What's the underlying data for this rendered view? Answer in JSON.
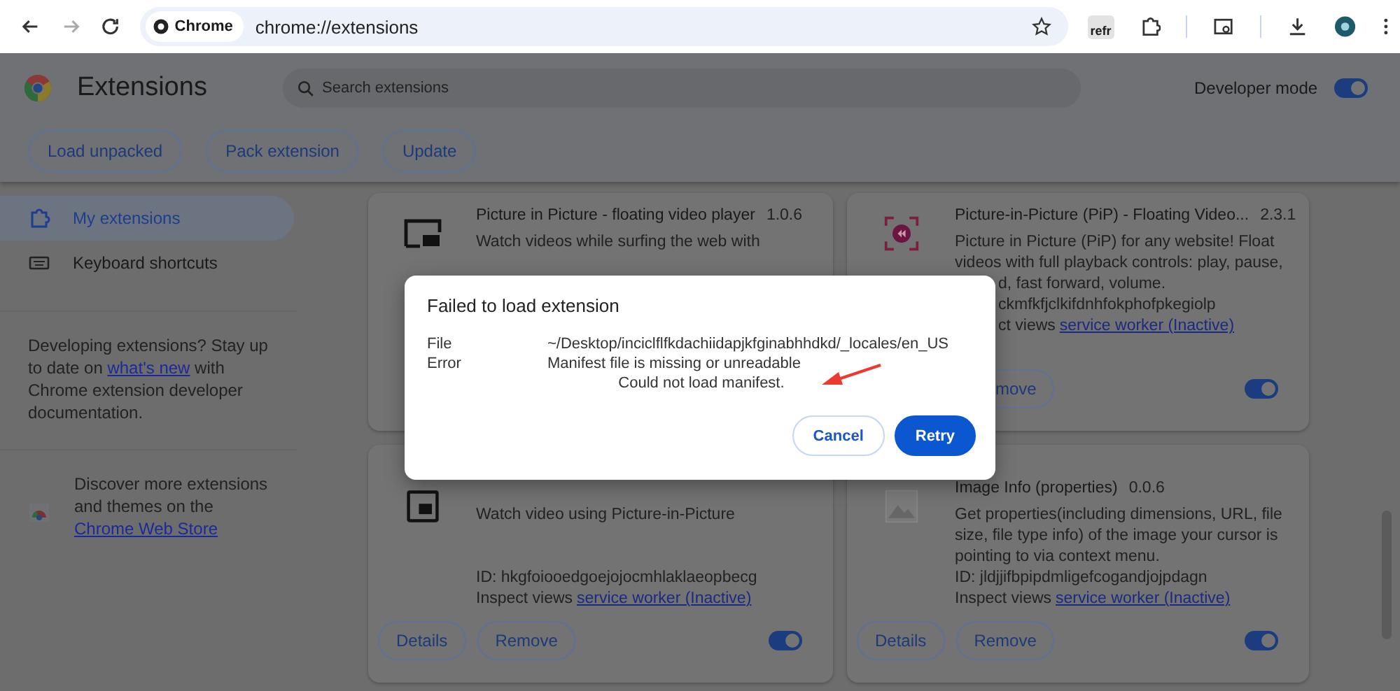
{
  "browser": {
    "site_chip": "Chrome",
    "url": "chrome://extensions",
    "extension_badge": "refr"
  },
  "header": {
    "title": "Extensions",
    "search_placeholder": "Search extensions",
    "developer_mode": {
      "label": "Developer mode",
      "on": true
    }
  },
  "toolbar_buttons": [
    "Load unpacked",
    "Pack extension",
    "Update"
  ],
  "sidebar": {
    "items": [
      {
        "label": "My extensions",
        "selected": true
      },
      {
        "label": "Keyboard shortcuts",
        "selected": false
      }
    ],
    "developer_note": {
      "before": "Developing extensions? Stay up to date on ",
      "link": "what's new",
      "after": " with Chrome extension developer documentation."
    },
    "store_note": {
      "before": "Discover more extensions and themes on the ",
      "link": "Chrome Web Store"
    }
  },
  "cards": [
    {
      "name": "Picture in Picture - floating video player",
      "version": "1.0.6",
      "description_lines": [
        "Watch videos while surfing the web with"
      ]
    },
    {
      "name": "Picture-in-Picture (PiP) - Floating Video...",
      "version": "2.3.1",
      "description_lines": [
        "Picture in Picture (PiP) for any website! Float",
        "videos with full playback controls: play, pause,"
      ],
      "cut_lines": [
        "d, fast forward, volume.",
        "ckmfkfjclkifdnhfokphofpkegiolp"
      ],
      "inspect_label": "ct views",
      "inspect_link": "service worker (Inactive)",
      "cut_buttons": [
        "move"
      ],
      "enabled": true
    },
    {
      "description_lines": [
        "Watch video using Picture-in-Picture"
      ],
      "id": "ID: hkgfoiooedgoejojocmhlaklaeopbecg",
      "inspect_label": "Inspect views",
      "inspect_link": "service worker (Inactive)",
      "buttons": [
        "Details",
        "Remove"
      ],
      "enabled": true
    },
    {
      "name": "Image Info (properties)",
      "version": "0.0.6",
      "description_lines": [
        "Get properties(including dimensions, URL, file",
        "size, file type info) of the image your cursor is",
        "pointing to via context menu."
      ],
      "id": "ID: jldjjifbpipdmligefcogandjojpdagn",
      "inspect_label": "Inspect views",
      "inspect_link": "service worker (Inactive)",
      "buttons": [
        "Details",
        "Remove"
      ],
      "enabled": true
    }
  ],
  "dialog": {
    "title": "Failed to load extension",
    "rows": [
      {
        "label": "File",
        "value": "~/Desktop/inciclflfkdachiidapjkfginabhhdkd/_locales/en_US"
      },
      {
        "label": "Error",
        "value": "Manifest file is missing or unreadable"
      }
    ],
    "message": "Could not load manifest.",
    "buttons": [
      {
        "label": "Cancel",
        "kind": "secondary"
      },
      {
        "label": "Retry",
        "kind": "primary"
      }
    ]
  }
}
